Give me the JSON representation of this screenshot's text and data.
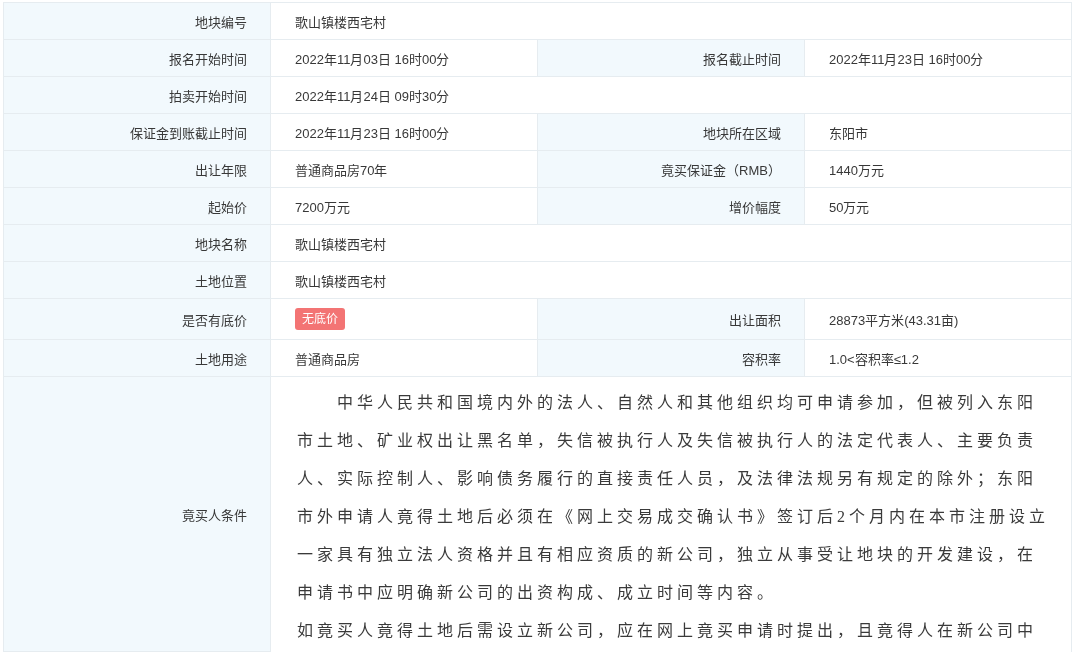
{
  "rows": [
    {
      "cells": [
        {
          "label": "地块编号",
          "value": "歌山镇楼西宅村",
          "kind": "text"
        }
      ]
    },
    {
      "cells": [
        {
          "label": "报名开始时间",
          "value": "2022年11月03日 16时00分",
          "kind": "text"
        },
        {
          "label": "报名截止时间",
          "value": "2022年11月23日 16时00分",
          "kind": "text"
        }
      ]
    },
    {
      "cells": [
        {
          "label": "拍卖开始时间",
          "value": "2022年11月24日 09时30分",
          "kind": "text"
        }
      ]
    },
    {
      "cells": [
        {
          "label": "保证金到账截止时间",
          "value": "2022年11月23日 16时00分",
          "kind": "text"
        },
        {
          "label": "地块所在区域",
          "value": "东阳市",
          "kind": "text"
        }
      ]
    },
    {
      "cells": [
        {
          "label": "出让年限",
          "value": "普通商品房70年",
          "kind": "text"
        },
        {
          "label": "竟买保证金（RMB）",
          "value": "1440万元",
          "kind": "text"
        }
      ]
    },
    {
      "cells": [
        {
          "label": "起始价",
          "value": "7200万元",
          "kind": "text"
        },
        {
          "label": "增价幅度",
          "value": "50万元",
          "kind": "text"
        }
      ]
    },
    {
      "cells": [
        {
          "label": "地块名称",
          "value": "歌山镇楼西宅村",
          "kind": "text"
        }
      ]
    },
    {
      "cells": [
        {
          "label": "土地位置",
          "value": "歌山镇楼西宅村",
          "kind": "text"
        }
      ]
    },
    {
      "cells": [
        {
          "label": "是否有底价",
          "value": "无底价",
          "kind": "tag"
        },
        {
          "label": "出让面积",
          "value": "28873平方米(43.31亩)",
          "kind": "text"
        }
      ]
    },
    {
      "cells": [
        {
          "label": "土地用途",
          "value": "普通商品房",
          "kind": "text"
        },
        {
          "label": "容积率",
          "value": "1.0<容积率≤1.2",
          "kind": "text"
        }
      ]
    }
  ],
  "conditions": {
    "label": "竟买人条件",
    "paragraphs": [
      {
        "text": "中华人民共和国境内外的法人、自然人和其他组织均可申请参加，但被列入东阳市土地、矿业权出让黑名单，失信被执行人及失信被执行人的法定代表人、主要负责人、实际控制人、影响债务履行的直接责任人员，及法律法规另有规定的除外；东阳市外申请人竟得土地后必须在《网上交易成交确认书》签订后2个月内在本市注册设立一家具有独立法人资格并且有相应资质的新公司，独立从事受让地块的开发建设，在申请书中应明确新公司的出资构成、成立时间等内容。",
        "indent": true
      },
      {
        "text": "如竟买人竟得土地后需设立新公司，应在网上竟买申请时提出，且竟得人在新公司中",
        "indent": false
      }
    ]
  }
}
